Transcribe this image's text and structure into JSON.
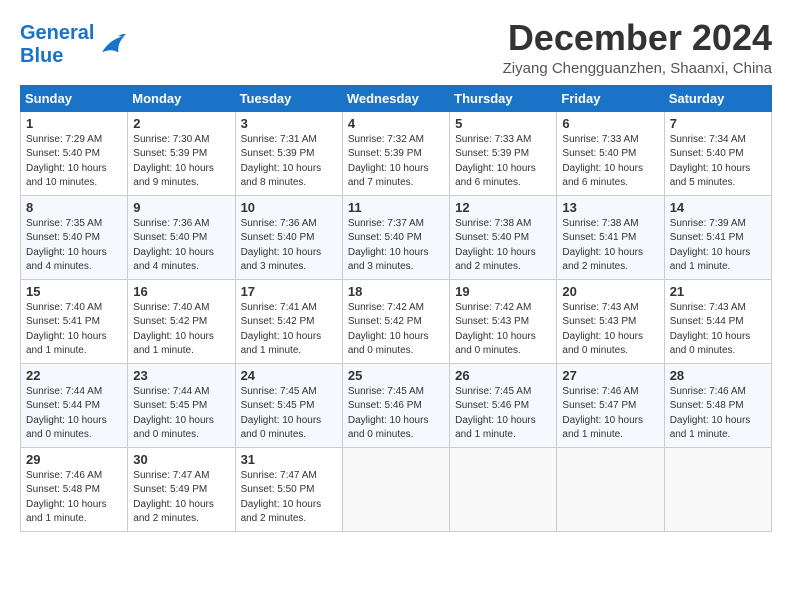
{
  "logo": {
    "line1": "General",
    "line2": "Blue"
  },
  "title": "December 2024",
  "subtitle": "Ziyang Chengguanzhen, Shaanxi, China",
  "days_header": [
    "Sunday",
    "Monday",
    "Tuesday",
    "Wednesday",
    "Thursday",
    "Friday",
    "Saturday"
  ],
  "weeks": [
    [
      {
        "day": "1",
        "info": "Sunrise: 7:29 AM\nSunset: 5:40 PM\nDaylight: 10 hours\nand 10 minutes."
      },
      {
        "day": "2",
        "info": "Sunrise: 7:30 AM\nSunset: 5:39 PM\nDaylight: 10 hours\nand 9 minutes."
      },
      {
        "day": "3",
        "info": "Sunrise: 7:31 AM\nSunset: 5:39 PM\nDaylight: 10 hours\nand 8 minutes."
      },
      {
        "day": "4",
        "info": "Sunrise: 7:32 AM\nSunset: 5:39 PM\nDaylight: 10 hours\nand 7 minutes."
      },
      {
        "day": "5",
        "info": "Sunrise: 7:33 AM\nSunset: 5:39 PM\nDaylight: 10 hours\nand 6 minutes."
      },
      {
        "day": "6",
        "info": "Sunrise: 7:33 AM\nSunset: 5:40 PM\nDaylight: 10 hours\nand 6 minutes."
      },
      {
        "day": "7",
        "info": "Sunrise: 7:34 AM\nSunset: 5:40 PM\nDaylight: 10 hours\nand 5 minutes."
      }
    ],
    [
      {
        "day": "8",
        "info": "Sunrise: 7:35 AM\nSunset: 5:40 PM\nDaylight: 10 hours\nand 4 minutes."
      },
      {
        "day": "9",
        "info": "Sunrise: 7:36 AM\nSunset: 5:40 PM\nDaylight: 10 hours\nand 4 minutes."
      },
      {
        "day": "10",
        "info": "Sunrise: 7:36 AM\nSunset: 5:40 PM\nDaylight: 10 hours\nand 3 minutes."
      },
      {
        "day": "11",
        "info": "Sunrise: 7:37 AM\nSunset: 5:40 PM\nDaylight: 10 hours\nand 3 minutes."
      },
      {
        "day": "12",
        "info": "Sunrise: 7:38 AM\nSunset: 5:40 PM\nDaylight: 10 hours\nand 2 minutes."
      },
      {
        "day": "13",
        "info": "Sunrise: 7:38 AM\nSunset: 5:41 PM\nDaylight: 10 hours\nand 2 minutes."
      },
      {
        "day": "14",
        "info": "Sunrise: 7:39 AM\nSunset: 5:41 PM\nDaylight: 10 hours\nand 1 minute."
      }
    ],
    [
      {
        "day": "15",
        "info": "Sunrise: 7:40 AM\nSunset: 5:41 PM\nDaylight: 10 hours\nand 1 minute."
      },
      {
        "day": "16",
        "info": "Sunrise: 7:40 AM\nSunset: 5:42 PM\nDaylight: 10 hours\nand 1 minute."
      },
      {
        "day": "17",
        "info": "Sunrise: 7:41 AM\nSunset: 5:42 PM\nDaylight: 10 hours\nand 1 minute."
      },
      {
        "day": "18",
        "info": "Sunrise: 7:42 AM\nSunset: 5:42 PM\nDaylight: 10 hours\nand 0 minutes."
      },
      {
        "day": "19",
        "info": "Sunrise: 7:42 AM\nSunset: 5:43 PM\nDaylight: 10 hours\nand 0 minutes."
      },
      {
        "day": "20",
        "info": "Sunrise: 7:43 AM\nSunset: 5:43 PM\nDaylight: 10 hours\nand 0 minutes."
      },
      {
        "day": "21",
        "info": "Sunrise: 7:43 AM\nSunset: 5:44 PM\nDaylight: 10 hours\nand 0 minutes."
      }
    ],
    [
      {
        "day": "22",
        "info": "Sunrise: 7:44 AM\nSunset: 5:44 PM\nDaylight: 10 hours\nand 0 minutes."
      },
      {
        "day": "23",
        "info": "Sunrise: 7:44 AM\nSunset: 5:45 PM\nDaylight: 10 hours\nand 0 minutes."
      },
      {
        "day": "24",
        "info": "Sunrise: 7:45 AM\nSunset: 5:45 PM\nDaylight: 10 hours\nand 0 minutes."
      },
      {
        "day": "25",
        "info": "Sunrise: 7:45 AM\nSunset: 5:46 PM\nDaylight: 10 hours\nand 0 minutes."
      },
      {
        "day": "26",
        "info": "Sunrise: 7:45 AM\nSunset: 5:46 PM\nDaylight: 10 hours\nand 1 minute."
      },
      {
        "day": "27",
        "info": "Sunrise: 7:46 AM\nSunset: 5:47 PM\nDaylight: 10 hours\nand 1 minute."
      },
      {
        "day": "28",
        "info": "Sunrise: 7:46 AM\nSunset: 5:48 PM\nDaylight: 10 hours\nand 1 minute."
      }
    ],
    [
      {
        "day": "29",
        "info": "Sunrise: 7:46 AM\nSunset: 5:48 PM\nDaylight: 10 hours\nand 1 minute."
      },
      {
        "day": "30",
        "info": "Sunrise: 7:47 AM\nSunset: 5:49 PM\nDaylight: 10 hours\nand 2 minutes."
      },
      {
        "day": "31",
        "info": "Sunrise: 7:47 AM\nSunset: 5:50 PM\nDaylight: 10 hours\nand 2 minutes."
      },
      {
        "day": "",
        "info": ""
      },
      {
        "day": "",
        "info": ""
      },
      {
        "day": "",
        "info": ""
      },
      {
        "day": "",
        "info": ""
      }
    ]
  ]
}
